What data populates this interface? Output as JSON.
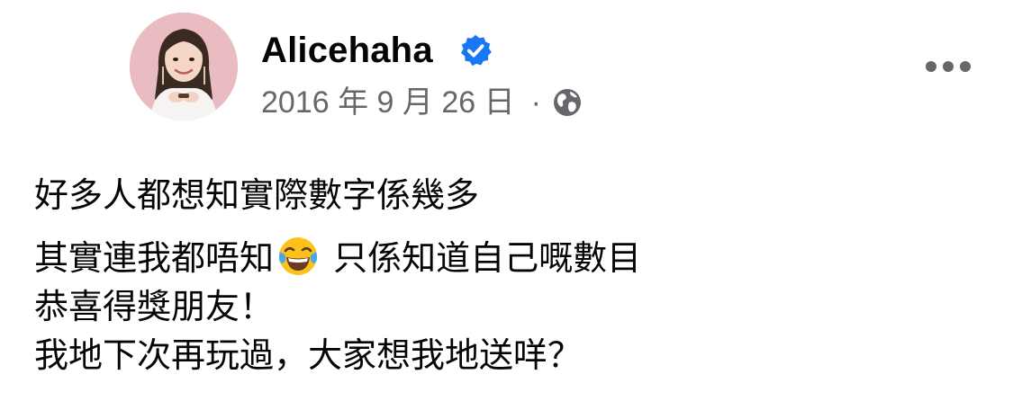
{
  "post": {
    "author": "Alicehaha",
    "date": "2016 年 9 月 26 日",
    "separator": "·",
    "audience_icon": "globe-icon",
    "verified_icon": "verified-badge-icon",
    "more_icon": "more-options-icon",
    "lines": [
      "好多人都想知實際數字係幾多",
      "其實連我都唔知",
      "只係知道自己嘅數目",
      "恭喜得獎朋友！",
      "我地下次再玩過，大家想我地送咩？"
    ],
    "emoji": "face-with-tears-of-joy-icon"
  },
  "colors": {
    "text_primary": "#050505",
    "text_secondary": "#65676b",
    "verified_blue": "#1877f2"
  }
}
